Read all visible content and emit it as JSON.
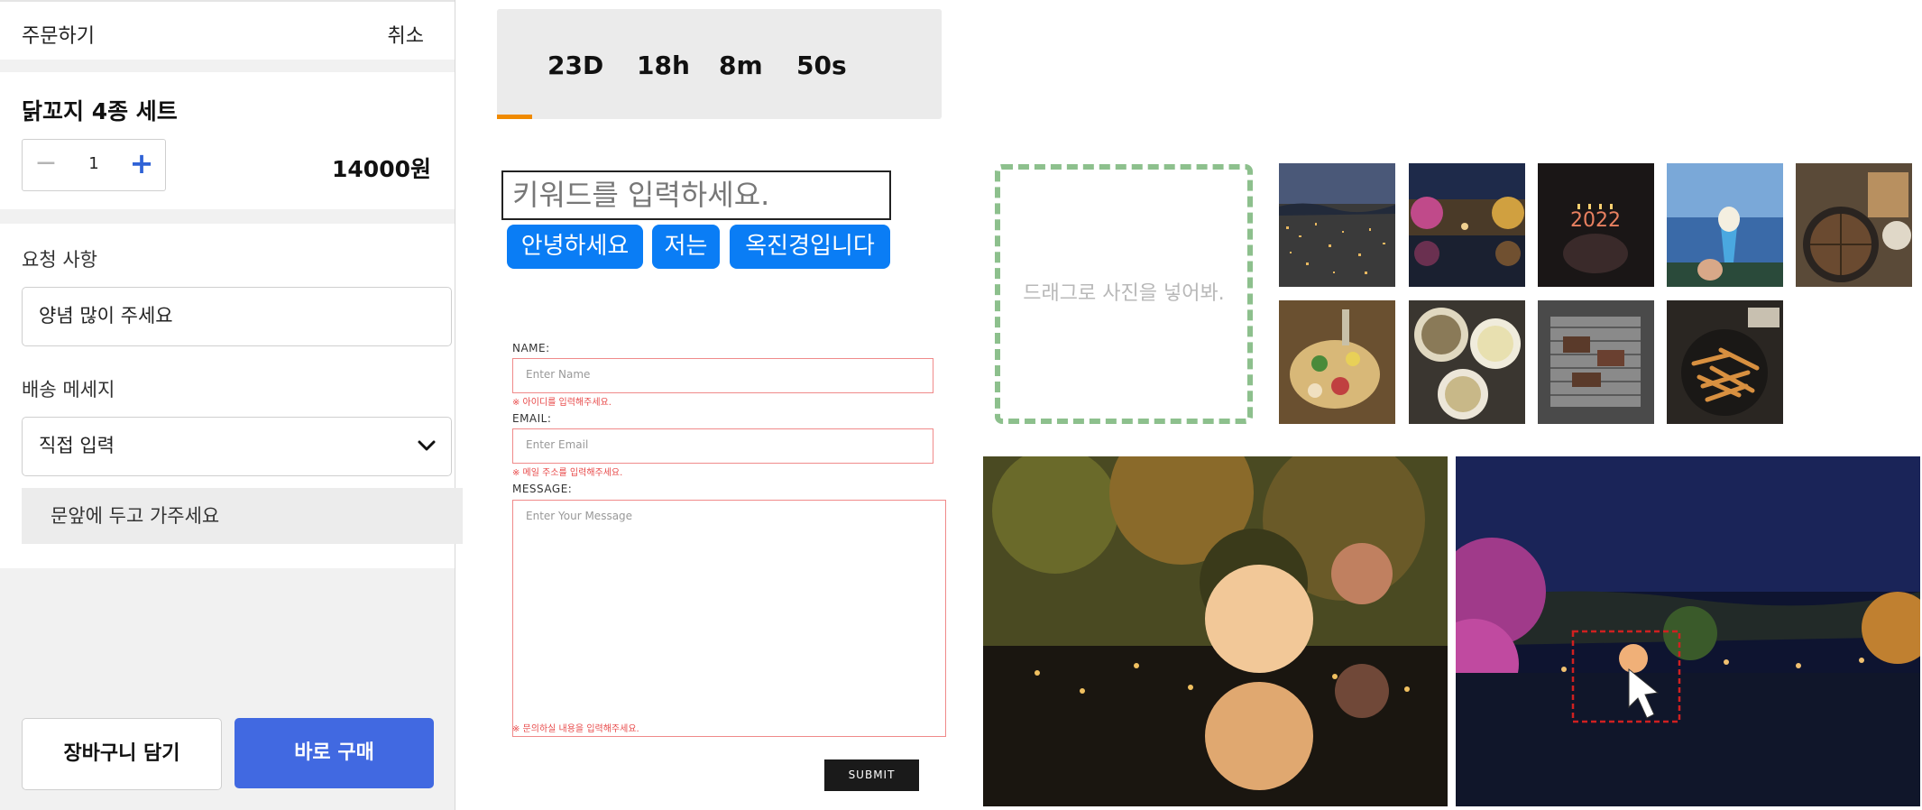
{
  "order": {
    "header": {
      "title": "주문하기",
      "cancel_label": "취소"
    },
    "product": {
      "name": "닭꼬지 4종 세트",
      "quantity": "1",
      "price": "14000원"
    },
    "request": {
      "label": "요청 사항",
      "value": "양념 많이 주세요"
    },
    "delivery": {
      "label": "배송 메세지",
      "selected": "직접 입력",
      "custom_message": "문앞에 두고 가주세요"
    },
    "buttons": {
      "cart": "장바구니 담기",
      "buy": "바로 구매"
    }
  },
  "countdown": {
    "days": "23D",
    "hours": "18h",
    "minutes": "8m",
    "seconds": "50s",
    "progress": 0.08
  },
  "keyword": {
    "placeholder": "키워드를 입력하세요.",
    "chips": [
      "안녕하세요",
      "저는",
      "옥진경입니다"
    ]
  },
  "contact_form": {
    "name": {
      "label": "NAME:",
      "placeholder": "Enter Name",
      "error": "※ 아이디를 입력해주세요."
    },
    "email": {
      "label": "EMAIL:",
      "placeholder": "Enter Email",
      "error": "※ 메일 주소를 입력해주세요."
    },
    "message": {
      "label": "MESSAGE:",
      "placeholder": "Enter Your Message",
      "error": "※ 문의하실 내용을 입력해주세요."
    },
    "submit_label": "SUBMIT"
  },
  "gallery": {
    "drop_text": "드래그로 사진을 넣어봐.",
    "thumbnails": [
      "city-night-photo",
      "lake-night-photo",
      "birthday-cake-photo",
      "ocean-icecream-photo",
      "pizza-photo",
      "fruit-platter-photo",
      "noodle-soup-photo",
      "grilled-meat-photo",
      "fries-photo"
    ]
  },
  "colors": {
    "accent_blue": "#4169e1",
    "chip_blue": "#0a7df5",
    "error_red": "#e84a4a",
    "progress_orange": "#f08a00",
    "dropzone_green": "#8dc08d"
  }
}
